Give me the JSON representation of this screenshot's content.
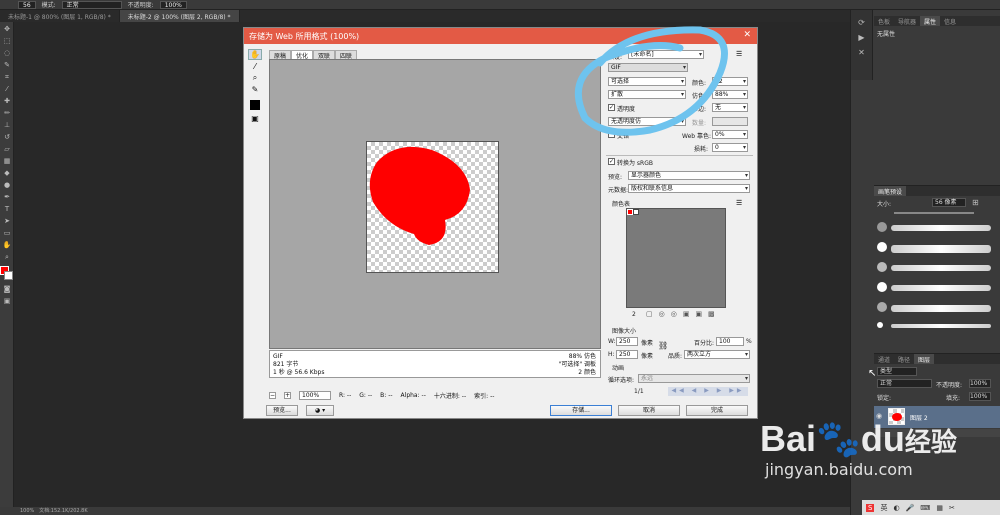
{
  "options_bar": {
    "size_value": "56",
    "mode_label": "模式:",
    "mode_value": "正常",
    "opacity_label": "不透明度:",
    "opacity_value": "100%"
  },
  "doc_tabs": [
    "未标题-1 @ 800% (图层 1, RGB/8) *",
    "未标题-2 @ 100% (图层 2, RGB/8) *"
  ],
  "statusbar": {
    "zoom": "100%",
    "doc": "文档:152.1K/202.8K"
  },
  "dialog": {
    "title": "存储为 Web 所用格式 (100%)",
    "view_tabs": [
      "原稿",
      "优化",
      "双联",
      "四联"
    ],
    "info_left": [
      "GIF",
      "821 字节",
      "1 秒 @ 56.6 Kbps"
    ],
    "info_right": [
      "88% 仿色",
      "\"可选择\" 调板",
      "2 颜色"
    ],
    "zoom": "100%",
    "readouts": {
      "r": "R: --",
      "g": "G: --",
      "b": "B: --",
      "alpha": "Alpha: --",
      "hex": "十六进制: --",
      "index": "索引: --"
    },
    "preset_label": "预设:",
    "preset_value": "[未命名]",
    "format_value": "GIF",
    "palette_value": "可选择",
    "dither_value": "扩散",
    "transparency_label": "透明度",
    "matte_value": "无透明度仿",
    "interlace_label": "交错",
    "colors_label": "颜色:",
    "colors_value": "32",
    "dither_pct_label": "仿色:",
    "dither_pct_value": "88%",
    "matte_label": "杂边:",
    "matte_color_value": "无",
    "amount_label": "数量:",
    "websnap_label": "Web 靠色:",
    "websnap_value": "0%",
    "lossy_label": "损耗:",
    "lossy_value": "0",
    "convert_srgb_label": "转换为 sRGB",
    "preview_label": "预览:",
    "preview_value": "显示器颜色",
    "metadata_label": "元数据:",
    "metadata_value": "版权和联系信息",
    "color_table_label": "颜色表",
    "color_count": "2",
    "image_size_label": "图像大小",
    "w_label": "W:",
    "w_value": "250",
    "h_label": "H:",
    "h_value": "250",
    "px_unit": "像素",
    "percent_label": "百分比:",
    "percent_value": "100",
    "pct_sign": "%",
    "quality_label": "品质:",
    "quality_value": "两次立方",
    "animation_label": "动画",
    "loop_label": "循环选项:",
    "loop_value": "永远",
    "frame_counter": "1/1",
    "buttons": {
      "preview": "预览...",
      "save": "存储...",
      "cancel": "取消",
      "done": "完成"
    },
    "colors": {
      "title_bar": "#e35a45",
      "red_shape": "#ff0000"
    }
  },
  "right_panels": {
    "top_tabs": [
      "色板",
      "导航器",
      "属性",
      "信息"
    ],
    "properties_text": "无属性",
    "brush_tabs": [
      "画笔预设"
    ],
    "brush_size_label": "大小:",
    "brush_size_value": "56 像素",
    "layer_tabs": [
      "通道",
      "路径",
      "图层"
    ],
    "layer_kind": "类型",
    "blend_mode": "正常",
    "opacity_label": "不透明度:",
    "opacity_value": "100%",
    "lock_label": "锁定:",
    "fill_label": "填充:",
    "fill_value": "100%",
    "layer_name": "图层 2"
  },
  "watermark": {
    "brand": "Bai",
    "brand2": "du",
    "suffix": "经验",
    "url": "jingyan.baidu.com"
  }
}
